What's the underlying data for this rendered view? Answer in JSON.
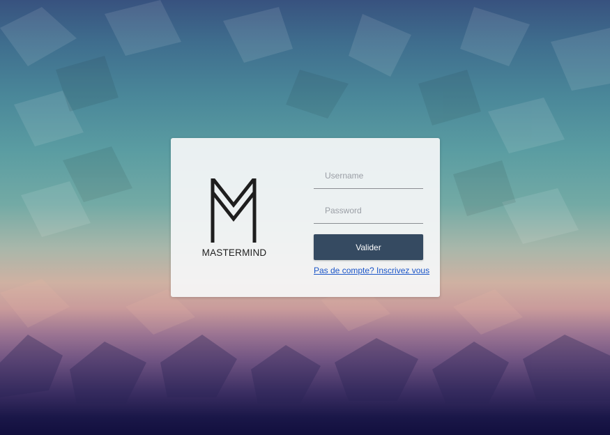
{
  "login": {
    "logo_text": "MASTERMIND",
    "username_placeholder": "Username",
    "password_placeholder": "Password",
    "submit_label": "Valider",
    "signup_link": "Pas de compte? Inscrivez vous"
  },
  "colors": {
    "button": "#354a61",
    "link": "#1a55c8",
    "logo": "#1e1e1e"
  },
  "icons": {
    "logo": "mastermind-m-logo"
  }
}
